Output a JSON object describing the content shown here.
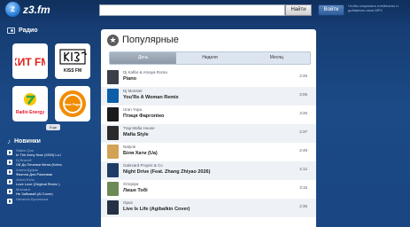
{
  "header": {
    "logo_glyph": "z",
    "logo_text": "z3.fm",
    "search_value": "",
    "search_button": "Найти",
    "login_button": "Войти",
    "login_note": "Чтобы сохранять плейлисты и добавлять свои MP3"
  },
  "sidebar": {
    "radio_heading": "Радио",
    "stations": [
      {
        "name": "ХИТ FM",
        "color": "#e2231a"
      },
      {
        "name": "KISS FM",
        "color": "#111111"
      },
      {
        "name": "Radio Energy",
        "color": "#e8132a"
      },
      {
        "name": "Наше Радио",
        "color": "#f28c00"
      }
    ],
    "all_link": "Еще",
    "news_heading": "Новинки",
    "news": [
      {
        "artist": "Status Quo",
        "title": "In The Army Now (1994) Lo-!"
      },
      {
        "artist": "Dj Bravoff",
        "title": "Ой До Печенки Меня (Keino"
      },
      {
        "artist": "Алина Дуфик",
        "title": "Фаэлла Для Разливая"
      },
      {
        "artist": "Velvet Echo",
        "title": "Love Love (Original Remix )"
      },
      {
        "artist": "Мохнатя",
        "title": "Не Забывай (Al Cover)"
      },
      {
        "artist": "Наталия Бучинська",
        "title": ""
      }
    ]
  },
  "main": {
    "title": "Популярные",
    "tabs": [
      "День",
      "Неделя",
      "Месяц"
    ],
    "active_tab": "День",
    "tracks": [
      {
        "artist": "Dj Kalfar & Amaya Roma",
        "title": "Piano",
        "duration": "2:26",
        "thumb_color": "#3a3f4a"
      },
      {
        "artist": "Dj Monster",
        "title": "You'Re A Woman Remix",
        "duration": "3:05",
        "thumb_color": "#0a5fa8"
      },
      {
        "artist": "Uran Yopa",
        "title": "Птиця Фаргопіно",
        "duration": "3:26",
        "thumb_color": "#1a1a1a"
      },
      {
        "artist": "Trap Mafia House",
        "title": "Mafia Style",
        "duration": "2:37",
        "thumb_color": "#2b2b2b"
      },
      {
        "artist": "Natyok",
        "title": "Біля Хати (Ua)",
        "duration": "2:49",
        "thumb_color": "#d3a256"
      },
      {
        "artist": "Galezard Project & Co",
        "title": "Night Drive (Feat. Zhang Zhiyao 2026)",
        "duration": "2:12",
        "thumb_color": "#1e3c64"
      },
      {
        "artist": "Хітеріум",
        "title": "Лише Тобі",
        "duration": "3:15",
        "thumb_color": "#6b8a55"
      },
      {
        "artist": "Opus",
        "title": "Live Is Life (Agibalkin Cover)",
        "duration": "2:35",
        "thumb_color": "#243044"
      }
    ]
  }
}
